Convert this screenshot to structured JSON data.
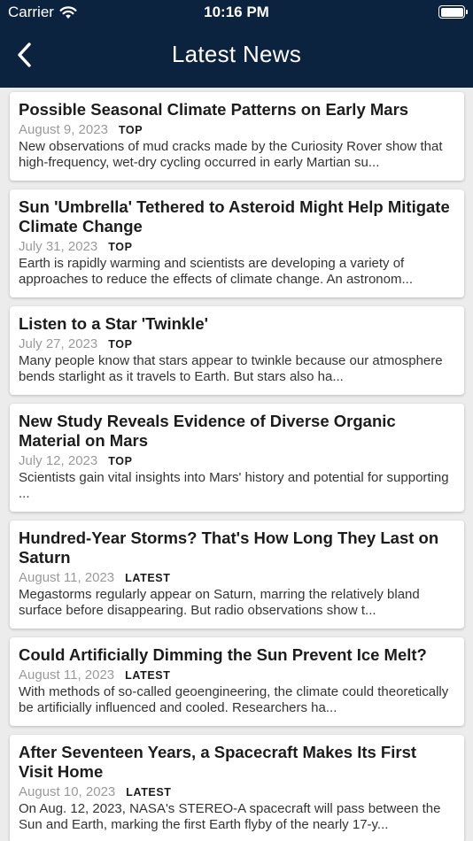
{
  "status": {
    "carrier": "Carrier",
    "time": "10:16 PM"
  },
  "header": {
    "title": "Latest News"
  },
  "articles": [
    {
      "title": "Possible Seasonal Climate Patterns on Early Mars",
      "date": "August 9, 2023",
      "tag": "TOP",
      "desc": "New observations of mud cracks made by the Curiosity Rover show that high-frequency, wet-dry cycling occurred in early Martian su..."
    },
    {
      "title": "Sun 'Umbrella' Tethered to Asteroid Might Help Mitigate Climate Change",
      "date": "July 31, 2023",
      "tag": "TOP",
      "desc": "Earth is rapidly warming and scientists are developing a variety of approaches to reduce the effects of climate change. An astronom..."
    },
    {
      "title": "Listen to a Star 'Twinkle'",
      "date": "July 27, 2023",
      "tag": "TOP",
      "desc": "Many people know that stars appear to twinkle because our atmosphere bends starlight as it travels to Earth. But stars also ha..."
    },
    {
      "title": "New Study Reveals Evidence of Diverse Organic Material on Mars",
      "date": "July 12, 2023",
      "tag": "TOP",
      "desc": "Scientists gain vital insights into Mars' history and potential for supporting ..."
    },
    {
      "title": "Hundred-Year Storms? That's How Long They Last on Saturn",
      "date": "August 11, 2023",
      "tag": "LATEST",
      "desc": "Megastorms regularly appear on Saturn, marring the relatively bland surface before disappearing. But radio observations show t..."
    },
    {
      "title": "Could Artificially Dimming the Sun Prevent Ice Melt?",
      "date": "August 11, 2023",
      "tag": "LATEST",
      "desc": "With methods of so-called geoengineering, the climate could theoretically be artificially influenced and cooled. Researchers ha..."
    },
    {
      "title": "After Seventeen Years, a Spacecraft Makes Its First Visit Home",
      "date": "August 10, 2023",
      "tag": "LATEST",
      "desc": "On Aug. 12, 2023, NASA's STEREO-A spacecraft will pass between the Sun and Earth, marking the first Earth flyby of the nearly 17-y..."
    }
  ],
  "icons": {
    "back": "chevron-left-icon",
    "wifi": "wifi-icon",
    "battery": "battery-icon"
  },
  "colors": {
    "header_bg": "#0c2340",
    "card_bg": "#ffffff",
    "page_bg": "#ececec",
    "date": "#9a9a9a"
  }
}
